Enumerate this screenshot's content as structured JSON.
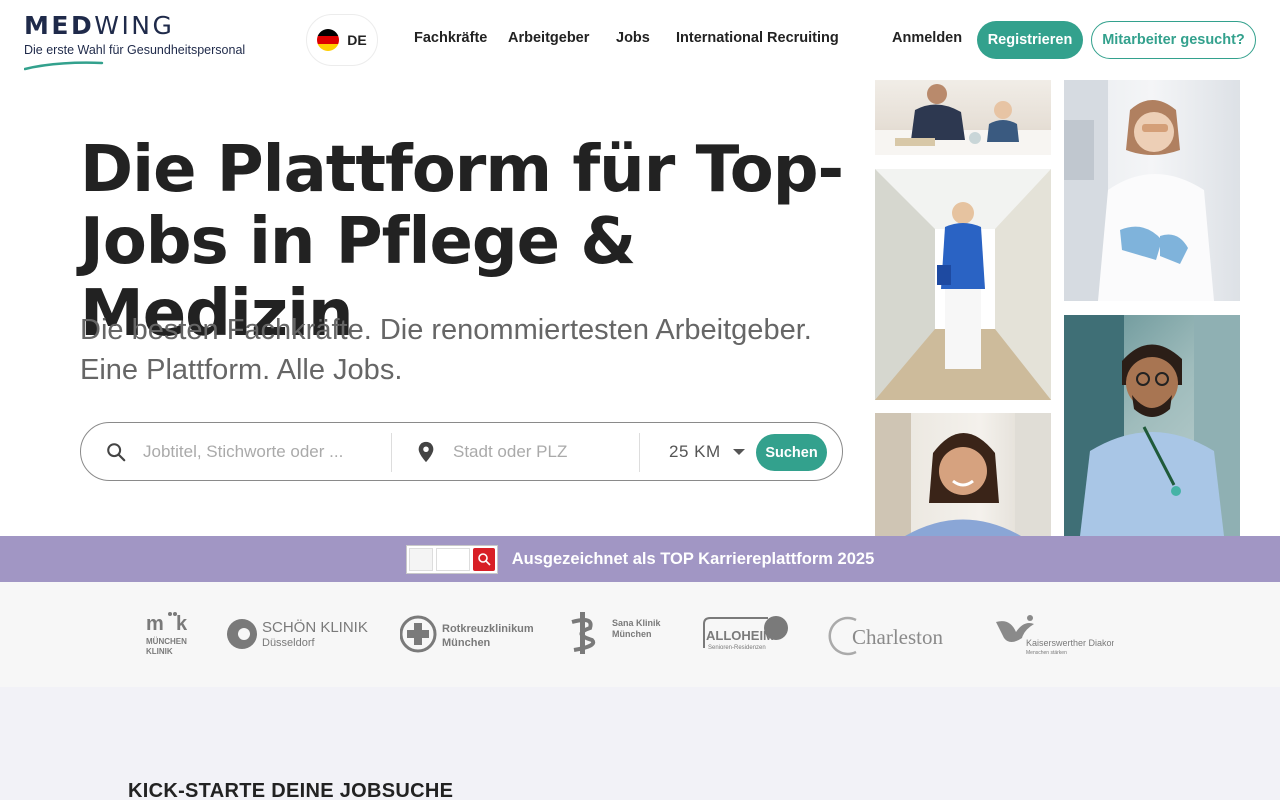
{
  "header": {
    "logo": {
      "wordmark_bold": "MED",
      "wordmark_light": "WING",
      "tagline": "Die erste Wahl für Gesundheitspersonal"
    },
    "language": {
      "code": "DE",
      "flag": "germany-flag-icon"
    },
    "nav": [
      "Fachkräfte",
      "Arbeitgeber",
      "Jobs",
      "International Recruiting"
    ],
    "login_label": "Anmelden",
    "register_label": "Registrieren",
    "employer_cta_label": "Mitarbeiter gesucht?"
  },
  "hero": {
    "title": "Die Plattform für Top-Jobs in Pflege & Medizin",
    "subtitle": "Die besten Fachkräfte. Die renommiertesten Arbeitgeber. Eine Plattform. Alle Jobs."
  },
  "search": {
    "keyword_placeholder": "Jobtitel, Stichworte oder ...",
    "keyword_value": "",
    "location_placeholder": "Stadt oder PLZ",
    "location_value": "",
    "radius": "25 KM",
    "submit_label": "Suchen",
    "icons": [
      "search-icon",
      "location-pin-icon",
      "caret-down-icon"
    ]
  },
  "award": {
    "text": "Ausgezeichnet als TOP Karriereplattform 2025"
  },
  "partner_logos": [
    "München Klinik",
    "Schön Klinik Düsseldorf",
    "Rotkreuzklinikum München",
    "Sana Klinik München",
    "Alloheim Senioren-Residenzen",
    "Charleston",
    "Kaiserswerther Diakonie"
  ],
  "section": {
    "heading": "KICK-STARTE DEINE JOBSUCHE"
  },
  "colors": {
    "brand_teal": "#33a18d",
    "award_bar": "#a196c4",
    "logo_navy": "#1f2a4a"
  }
}
